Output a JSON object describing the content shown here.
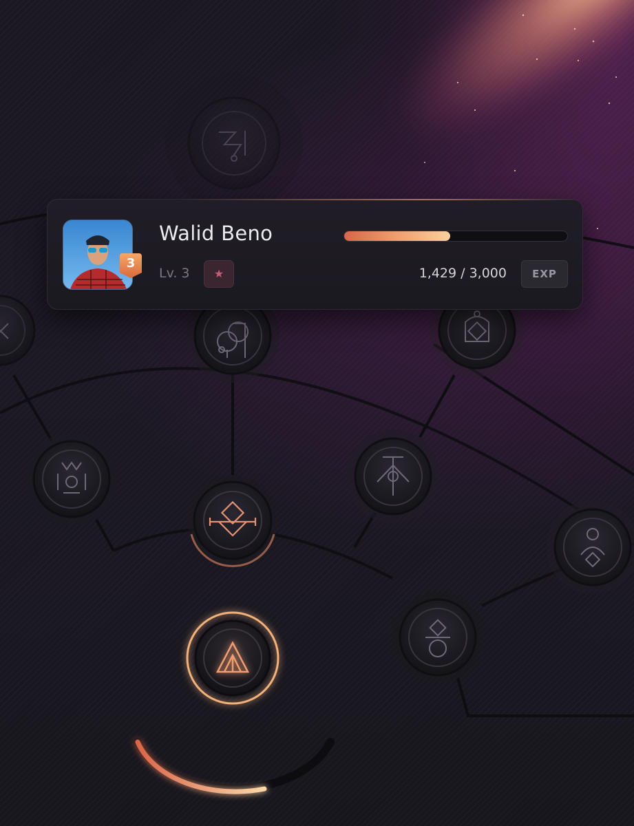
{
  "player": {
    "name": "Walid Beno",
    "level_label": "Lv. 3",
    "rank_badge": "3",
    "exp_text": "1,429 / 3,000",
    "exp_button": "EXP",
    "exp_progress": 0.476
  },
  "skill_tree": {
    "nodes": [
      {
        "name": "node-top-locked",
        "state": "locked",
        "icon": "bird-triangle-icon"
      },
      {
        "name": "node-left-edge",
        "state": "locked",
        "icon": "crossed-arrows-icon"
      },
      {
        "name": "node-orbit",
        "state": "locked",
        "icon": "orbit-circles-icon"
      },
      {
        "name": "node-right-upper",
        "state": "locked",
        "icon": "diamond-ring-icon"
      },
      {
        "name": "node-left-mid",
        "state": "locked",
        "icon": "crowned-circle-icon"
      },
      {
        "name": "node-eye",
        "state": "locked",
        "icon": "eye-pillar-icon"
      },
      {
        "name": "node-right-far",
        "state": "locked",
        "icon": "figure-diamond-icon"
      },
      {
        "name": "node-diamond-unlocked",
        "state": "unlocked",
        "icon": "diamond-arrow-icon"
      },
      {
        "name": "node-active",
        "state": "active",
        "icon": "peak-triangle-icon"
      },
      {
        "name": "node-gem",
        "state": "locked",
        "icon": "gem-circle-icon"
      }
    ],
    "bottom_arc_progress": 0.6
  },
  "colors": {
    "accent": "#f2b27a",
    "accent_deep": "#d9664a",
    "badge": "#e07a47",
    "star": "#c45f73"
  }
}
